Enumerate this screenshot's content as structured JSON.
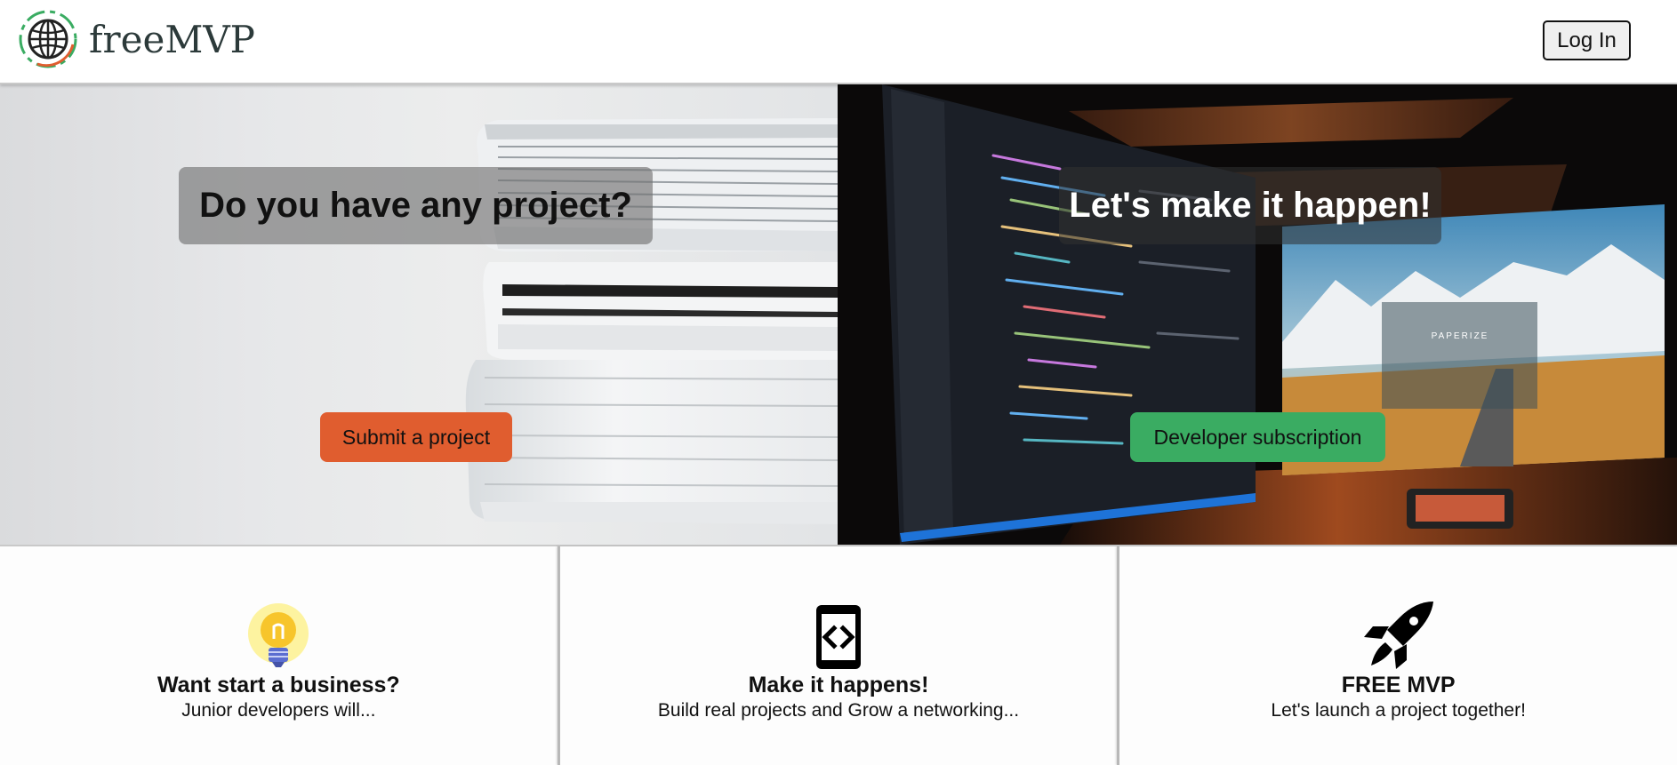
{
  "header": {
    "brand_name": "freeMVP",
    "logo_icon": "globe-icon",
    "login_label": "Log In"
  },
  "hero": {
    "left": {
      "title": "Do you have any project?",
      "button_label": "Submit a project",
      "button_color": "#e05d2f",
      "background": "stack-of-binders-photo"
    },
    "right": {
      "title": "Let's make it happen!",
      "button_label": "Developer subscription",
      "button_color": "#3aac62",
      "background": "code-editor-monitors-photo",
      "monitor_text": "PAPERIZE"
    }
  },
  "features": [
    {
      "icon": "lightbulb-icon",
      "title": "Want start a business?",
      "subtitle": "Junior developers will..."
    },
    {
      "icon": "code-device-icon",
      "title": "Make it happens!",
      "subtitle": "Build real projects and Grow a networking..."
    },
    {
      "icon": "rocket-icon",
      "title": "FREE MVP",
      "subtitle": "Let's launch a project together!"
    }
  ]
}
